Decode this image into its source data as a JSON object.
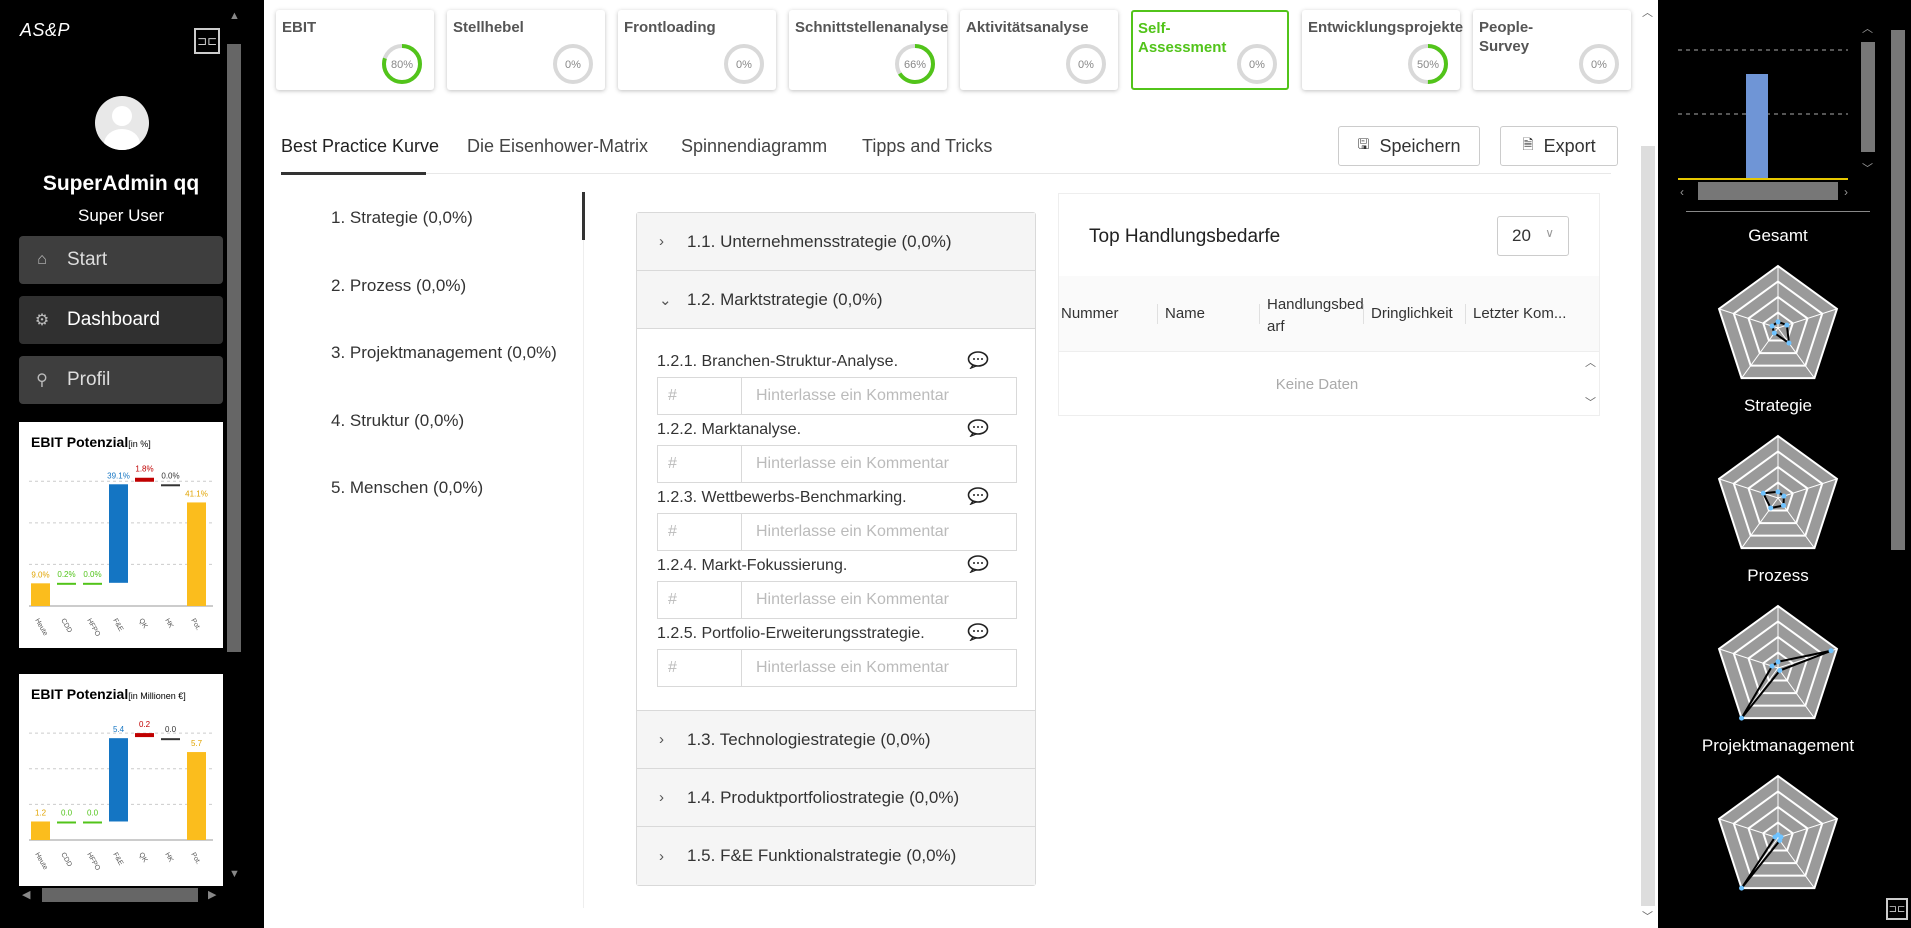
{
  "sidebar": {
    "logo": "AS&P",
    "user_name": "SuperAdmin qq",
    "user_role": "Super User",
    "nav": [
      {
        "label": "Start",
        "icon": "home-icon"
      },
      {
        "label": "Dashboard",
        "icon": "gear-icon"
      },
      {
        "label": "Profil",
        "icon": "user-icon"
      }
    ],
    "ebit_cards": [
      {
        "title": "EBIT Potenzial",
        "unit": "[in %]",
        "categories": [
          "Heute",
          "CDD",
          "HFPO",
          "F&E",
          "QK",
          "HK",
          "Pot."
        ],
        "values": [
          "9.0%",
          "0.2%",
          "0.0%",
          "39.1%",
          "1.8%",
          "0.0%",
          "41.1%"
        ]
      },
      {
        "title": "EBIT Potenzial",
        "unit": "[in Millionen €]",
        "categories": [
          "Heute",
          "CDD",
          "HFPO",
          "F&E",
          "QK",
          "HK",
          "Pot."
        ],
        "values": [
          "1.2",
          "0.0",
          "0.0",
          "5.4",
          "0.2",
          "0.0",
          "5.7"
        ]
      }
    ]
  },
  "tiles": [
    {
      "label": "EBIT",
      "percent": "80%",
      "value": 0.8
    },
    {
      "label": "Stellhebel",
      "percent": "0%",
      "value": 0
    },
    {
      "label": "Frontloading",
      "percent": "0%",
      "value": 0
    },
    {
      "label": "Schnittstellenanalyse",
      "percent": "66%",
      "value": 0.66
    },
    {
      "label": "Aktivitätsanalyse",
      "percent": "0%",
      "value": 0
    },
    {
      "label": "Self-Assessment",
      "percent": "0%",
      "value": 0,
      "selected": true
    },
    {
      "label": "Entwicklungsprojekte",
      "percent": "50%",
      "value": 0.5
    },
    {
      "label": "People-Survey",
      "percent": "0%",
      "value": 0
    }
  ],
  "tabs": [
    "Best Practice Kurve",
    "Die Eisenhower-Matrix",
    "Spinnendiagramm",
    "Tipps and Tricks"
  ],
  "actions": {
    "save": "Speichern",
    "export": "Export"
  },
  "categories": [
    "1. Strategie (0,0%)",
    "2. Prozess (0,0%)",
    "3. Projektmanagement (0,0%)",
    "4. Struktur (0,0%)",
    "5. Menschen (0,0%)"
  ],
  "accordion": {
    "sections": [
      "1.1. Unternehmensstrategie (0,0%)",
      "1.2. Marktstrategie (0,0%)",
      "1.3. Technologiestrategie (0,0%)",
      "1.4. Produktportfoliostrategie (0,0%)",
      "1.5. F&E Funktionalstrategie (0,0%)"
    ],
    "questions": [
      "1.2.1. Branchen-Struktur-Analyse.",
      "1.2.2. Marktanalyse.",
      "1.2.3. Wettbewerbs-Benchmarking.",
      "1.2.4. Markt-Fokussierung.",
      "1.2.5. Portfolio-Erweiterungsstrategie."
    ],
    "number_placeholder": "#",
    "comment_placeholder": "Hinterlasse ein Kommentar"
  },
  "top_card": {
    "title": "Top Handlungsbedarfe",
    "count": "20",
    "columns": [
      "Nummer",
      "Name",
      "Handlungsbed arf",
      "Dringlichkeit",
      "Letzter Kom..."
    ],
    "empty": "Keine Daten"
  },
  "right_panel": {
    "labels": [
      "Gesamt",
      "Strategie",
      "Prozess",
      "Projektmanagement"
    ]
  },
  "colors": {
    "accent_green": "#52c41a",
    "bar_blue": "#1475c3",
    "bar_yellow": "#fbbd1d",
    "bar_red": "#c00000"
  }
}
